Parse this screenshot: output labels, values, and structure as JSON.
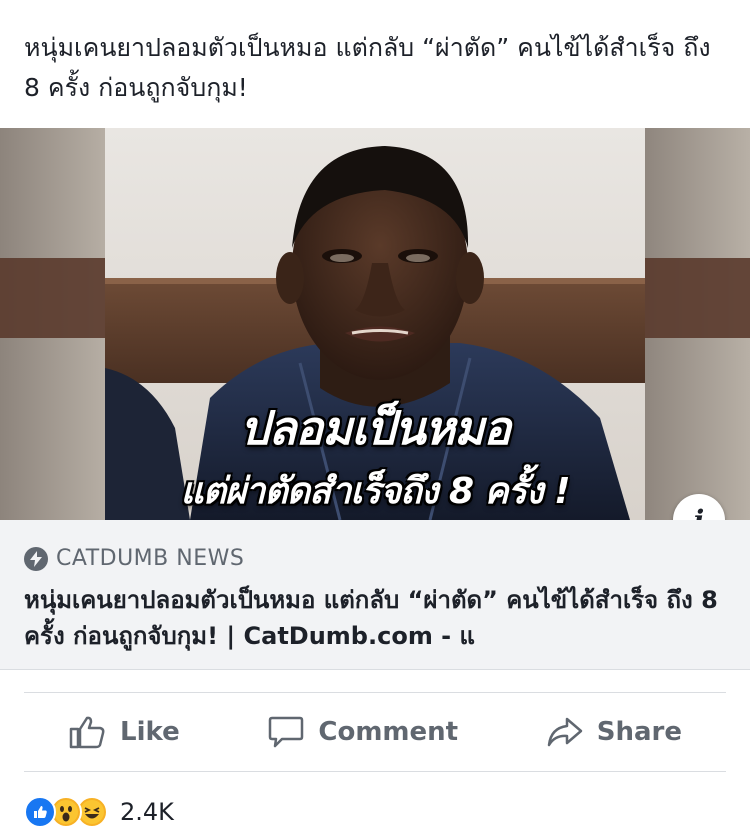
{
  "post": {
    "text": "หนุ่มเคนยาปลอมตัวเป็นหมอ แต่กลับ “ผ่าตัด” คนไข้ได้สำเร็จ ถึง 8 ครั้ง ก่อนถูกจับกุม!"
  },
  "link_card": {
    "image": {
      "overlay_line1": "ปลอมเป็นหมอ",
      "overlay_line2": "แต่ผ่าตัดสำเร็จถึง 8 ครั้ง !"
    },
    "info_icon": "info-icon",
    "source": "CATDUMB NEWS",
    "source_icon": "lightning-bolt-icon",
    "title": "หนุ่มเคนยาปลอมตัวเป็นหมอ แต่กลับ “ผ่าตัด” คนไข้ได้สำเร็จ ถึง 8 ครั้ง ก่อนถูกจับกุม! | CatDumb.com - แ"
  },
  "actions": {
    "like_label": "Like",
    "comment_label": "Comment",
    "share_label": "Share"
  },
  "reactions": {
    "types": [
      "like",
      "wow",
      "haha"
    ],
    "count": "2.4K"
  },
  "colors": {
    "text_primary": "#1d2129",
    "text_secondary": "#606770",
    "card_background": "#f2f3f5",
    "like_blue": "#1877f2",
    "reaction_yellow": "#f7b125"
  }
}
